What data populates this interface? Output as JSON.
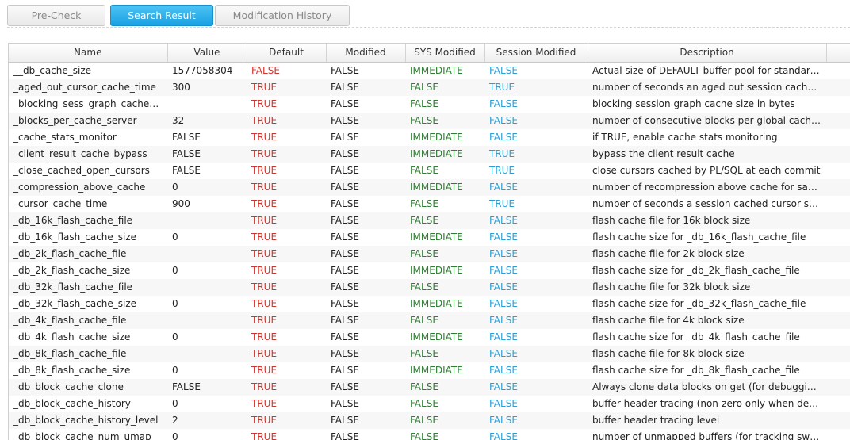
{
  "tabs": [
    {
      "label": "Pre-Check"
    },
    {
      "label": "Search Result"
    },
    {
      "label": "Modification History"
    }
  ],
  "colors": {
    "false_default": "#d0342c",
    "sys_modified": "#2e7d32",
    "session_modified": "#2a9fd6",
    "active_tab": "#1aa1e3"
  },
  "table": {
    "headers": [
      "Name",
      "Value",
      "Default",
      "Modified",
      "SYS Modified",
      "Session Modified",
      "Description"
    ],
    "rows": [
      [
        "__db_cache_size",
        "1577058304",
        "FALSE",
        "FALSE",
        "IMMEDIATE",
        "FALSE",
        "Actual size of DEFAULT buffer pool for standard block size buffers"
      ],
      [
        "_aged_out_cursor_cache_time",
        "300",
        "TRUE",
        "FALSE",
        "FALSE",
        "TRUE",
        "number of seconds an aged out session cached cursor stay in cache"
      ],
      [
        "_blocking_sess_graph_cache_size",
        "",
        "TRUE",
        "FALSE",
        "FALSE",
        "FALSE",
        "blocking session graph cache size in bytes"
      ],
      [
        "_blocks_per_cache_server",
        "32",
        "TRUE",
        "FALSE",
        "FALSE",
        "FALSE",
        "number of consecutive blocks per global cache server"
      ],
      [
        "_cache_stats_monitor",
        "FALSE",
        "TRUE",
        "FALSE",
        "IMMEDIATE",
        "FALSE",
        "if TRUE, enable cache stats monitoring"
      ],
      [
        "_client_result_cache_bypass",
        "FALSE",
        "TRUE",
        "FALSE",
        "IMMEDIATE",
        "TRUE",
        "bypass the client result cache"
      ],
      [
        "_close_cached_open_cursors",
        "FALSE",
        "TRUE",
        "FALSE",
        "FALSE",
        "TRUE",
        "close cursors cached by PL/SQL at each commit"
      ],
      [
        "_compression_above_cache",
        "0",
        "TRUE",
        "FALSE",
        "IMMEDIATE",
        "FALSE",
        "number of recompression above cache for sanity check"
      ],
      [
        "_cursor_cache_time",
        "900",
        "TRUE",
        "FALSE",
        "FALSE",
        "TRUE",
        "number of seconds a session cached cursor stay in cache"
      ],
      [
        "_db_16k_flash_cache_file",
        "",
        "TRUE",
        "FALSE",
        "FALSE",
        "FALSE",
        "flash cache file for 16k block size"
      ],
      [
        "_db_16k_flash_cache_size",
        "0",
        "TRUE",
        "FALSE",
        "IMMEDIATE",
        "FALSE",
        "flash cache size for _db_16k_flash_cache_file"
      ],
      [
        "_db_2k_flash_cache_file",
        "",
        "TRUE",
        "FALSE",
        "FALSE",
        "FALSE",
        "flash cache file for 2k block size"
      ],
      [
        "_db_2k_flash_cache_size",
        "0",
        "TRUE",
        "FALSE",
        "IMMEDIATE",
        "FALSE",
        "flash cache size for _db_2k_flash_cache_file"
      ],
      [
        "_db_32k_flash_cache_file",
        "",
        "TRUE",
        "FALSE",
        "FALSE",
        "FALSE",
        "flash cache file for 32k block size"
      ],
      [
        "_db_32k_flash_cache_size",
        "0",
        "TRUE",
        "FALSE",
        "IMMEDIATE",
        "FALSE",
        "flash cache size for _db_32k_flash_cache_file"
      ],
      [
        "_db_4k_flash_cache_file",
        "",
        "TRUE",
        "FALSE",
        "FALSE",
        "FALSE",
        "flash cache file for 4k block size"
      ],
      [
        "_db_4k_flash_cache_size",
        "0",
        "TRUE",
        "FALSE",
        "IMMEDIATE",
        "FALSE",
        "flash cache size for _db_4k_flash_cache_file"
      ],
      [
        "_db_8k_flash_cache_file",
        "",
        "TRUE",
        "FALSE",
        "FALSE",
        "FALSE",
        "flash cache file for 8k block size"
      ],
      [
        "_db_8k_flash_cache_size",
        "0",
        "TRUE",
        "FALSE",
        "IMMEDIATE",
        "FALSE",
        "flash cache size for _db_8k_flash_cache_file"
      ],
      [
        "_db_block_cache_clone",
        "FALSE",
        "TRUE",
        "FALSE",
        "FALSE",
        "FALSE",
        "Always clone data blocks on get (for debugging)"
      ],
      [
        "_db_block_cache_history",
        "0",
        "TRUE",
        "FALSE",
        "FALSE",
        "FALSE",
        "buffer header tracing (non-zero only when debugging)"
      ],
      [
        "_db_block_cache_history_level",
        "2",
        "TRUE",
        "FALSE",
        "FALSE",
        "FALSE",
        "buffer header tracing level"
      ],
      [
        "_db_block_cache_num_umap",
        "0",
        "TRUE",
        "FALSE",
        "FALSE",
        "FALSE",
        "number of unmapped buffers (for tracking swap calls on blocks)"
      ]
    ]
  }
}
